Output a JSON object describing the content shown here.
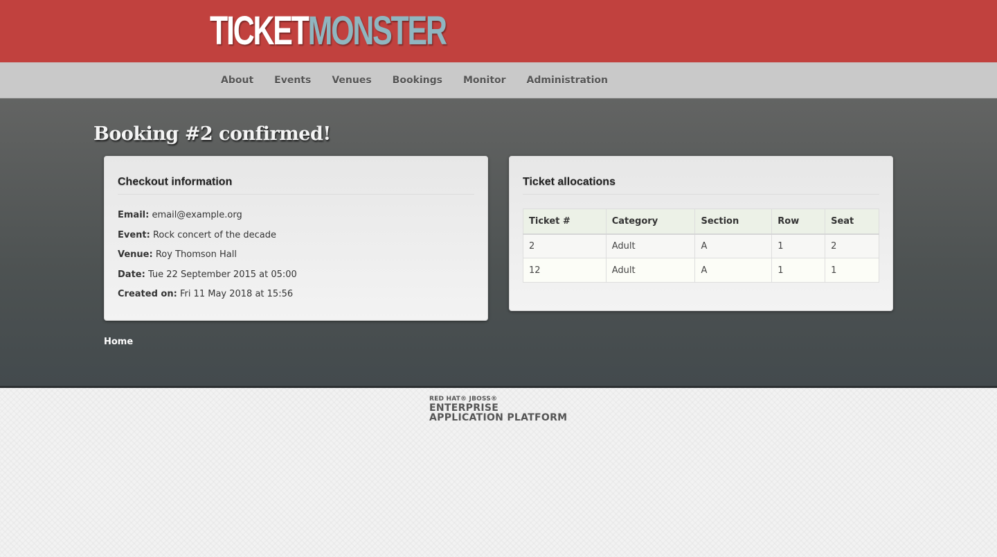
{
  "header": {
    "logo_part1": "TICKET",
    "logo_part2": "MONSTER"
  },
  "nav": {
    "items": [
      "About",
      "Events",
      "Venues",
      "Bookings",
      "Monitor",
      "Administration"
    ]
  },
  "page": {
    "title": "Booking #2 confirmed!"
  },
  "checkout": {
    "title": "Checkout information",
    "rows": [
      {
        "label": "Email:",
        "value": "email@example.org"
      },
      {
        "label": "Event:",
        "value": "Rock concert of the decade"
      },
      {
        "label": "Venue:",
        "value": "Roy Thomson Hall"
      },
      {
        "label": "Date:",
        "value": "Tue 22 September 2015 at 05:00"
      },
      {
        "label": "Created on:",
        "value": "Fri 11 May 2018 at 15:56"
      }
    ]
  },
  "tickets": {
    "title": "Ticket allocations",
    "columns": [
      "Ticket #",
      "Category",
      "Section",
      "Row",
      "Seat"
    ],
    "rows": [
      [
        "2",
        "Adult",
        "A",
        "1",
        "2"
      ],
      [
        "12",
        "Adult",
        "A",
        "1",
        "1"
      ]
    ]
  },
  "links": {
    "home": "Home"
  },
  "footer": {
    "line1": "RED HAT® JBOSS®",
    "line2": "ENTERPRISE",
    "line3": "APPLICATION PLATFORM"
  },
  "colors": {
    "header_red": "#c1413e",
    "logo_blue": "#8fb6c0",
    "nav_gray": "#c9c9c9",
    "table_header": "#ecf1e7"
  }
}
